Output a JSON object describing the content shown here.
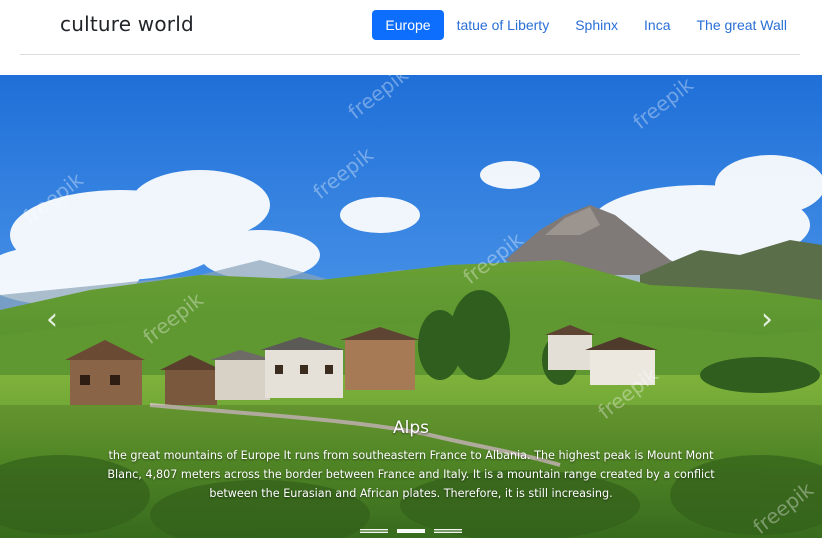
{
  "navbar": {
    "brand": "culture world",
    "items": [
      {
        "label": "Europe",
        "active": true
      },
      {
        "label": "tatue of Liberty",
        "active": false
      },
      {
        "label": "Sphinx",
        "active": false
      },
      {
        "label": "Inca",
        "active": false
      },
      {
        "label": "The great Wall",
        "active": false
      }
    ]
  },
  "carousel": {
    "prev_icon": "chevron-left-icon",
    "next_icon": "chevron-right-icon",
    "prev_glyph": "‹",
    "next_glyph": "›",
    "caption": {
      "title": "Alps",
      "text": "the great mountains of Europe It runs from southeastern France to Albania. The highest peak is Mount Mont Blanc, 4,807 meters across the border between France and Italy. It is a mountain range created by a conflict between the Eurasian and African plates. Therefore, it is still increasing."
    },
    "watermark": "freepik",
    "indicators": [
      false,
      true,
      false
    ]
  },
  "colors": {
    "accent": "#0d6efd",
    "link": "#2a6fd6"
  }
}
